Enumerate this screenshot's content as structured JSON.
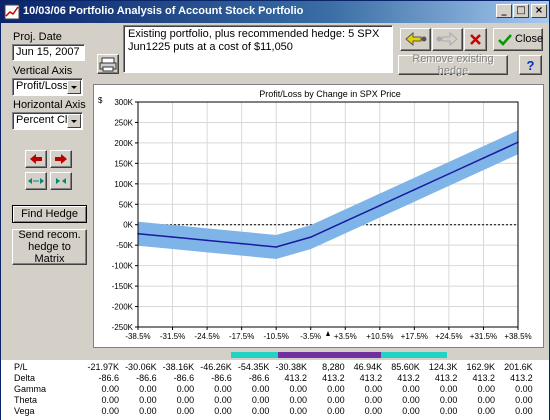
{
  "window": {
    "title": "10/03/06  Portfolio Analysis of Account  Stock Portfolio",
    "minimize": "_",
    "maximize": "□",
    "close": "×"
  },
  "left_panel": {
    "proj_date_label": "Proj. Date",
    "proj_date_value": "Jun 15, 2007",
    "vertical_axis_label": "Vertical Axis",
    "vertical_axis_value": "Profit/Loss",
    "horizontal_axis_label": "Horizontal Axis",
    "horizontal_axis_value": "Percent Chg",
    "find_hedge_label": "Find Hedge",
    "send_recom_label": "Send recom. hedge to Matrix"
  },
  "message": "Existing portfolio, plus recommended hedge: 5 SPX Jun1225 puts at a cost of $11,050",
  "toolbar": {
    "close_label": "Close",
    "remove_hedge_label": "Remove existing hedge",
    "help_label": "?"
  },
  "colors": {
    "curve": "#1a1aa0",
    "band": "#7fb4e8",
    "zero_line": "#000000"
  },
  "chart_data": {
    "type": "line",
    "title": "Profit/Loss by Change in SPX Price",
    "ylabel": "$",
    "xlabel": "",
    "xlim": [
      -38.5,
      38.5
    ],
    "ylim": [
      -250000,
      300000
    ],
    "x_ticks": [
      "-38.5%",
      "-31.5%",
      "-24.5%",
      "-17.5%",
      "-10.5%",
      "-3.5%",
      "+3.5%",
      "+10.5%",
      "+17.5%",
      "+24.5%",
      "+31.5%",
      "+38.5%"
    ],
    "y_ticks": [
      "300K",
      "250K",
      "200K",
      "150K",
      "100K",
      "50K",
      "0K",
      "-50K",
      "-100K",
      "-150K",
      "-200K",
      "-250K"
    ],
    "grid": true,
    "series": [
      {
        "x": [
          -38.5,
          -31.5,
          -24.5,
          -17.5,
          -10.5,
          -3.5,
          3.5,
          10.5,
          17.5,
          24.5,
          31.5,
          38.5
        ],
        "values": [
          -21970,
          -30060,
          -38160,
          -46260,
          -54350,
          -30380,
          8280,
          46940,
          85600,
          124300,
          162900,
          201600
        ]
      }
    ]
  },
  "stats": {
    "rows": [
      {
        "label": "P/L",
        "values": [
          "-21.97K",
          "-30.06K",
          "-38.16K",
          "-46.26K",
          "-54.35K",
          "-30.38K",
          "8,280",
          "46.94K",
          "85.60K",
          "124.3K",
          "162.9K",
          "201.6K"
        ]
      },
      {
        "label": "Delta",
        "values": [
          "-86.6",
          "-86.6",
          "-86.6",
          "-86.6",
          "-86.6",
          "413.2",
          "413.2",
          "413.2",
          "413.2",
          "413.2",
          "413.2",
          "413.2"
        ]
      },
      {
        "label": "Gamma",
        "values": [
          "0.00",
          "0.00",
          "0.00",
          "0.00",
          "0.00",
          "0.00",
          "0.00",
          "0.00",
          "0.00",
          "0.00",
          "0.00",
          "0.00"
        ]
      },
      {
        "label": "Theta",
        "values": [
          "0.00",
          "0.00",
          "0.00",
          "0.00",
          "0.00",
          "0.00",
          "0.00",
          "0.00",
          "0.00",
          "0.00",
          "0.00",
          "0.00"
        ]
      },
      {
        "label": "Vega",
        "values": [
          "0.00",
          "0.00",
          "0.00",
          "0.00",
          "0.00",
          "0.00",
          "0.00",
          "0.00",
          "0.00",
          "0.00",
          "0.00",
          "0.00"
        ]
      }
    ]
  }
}
